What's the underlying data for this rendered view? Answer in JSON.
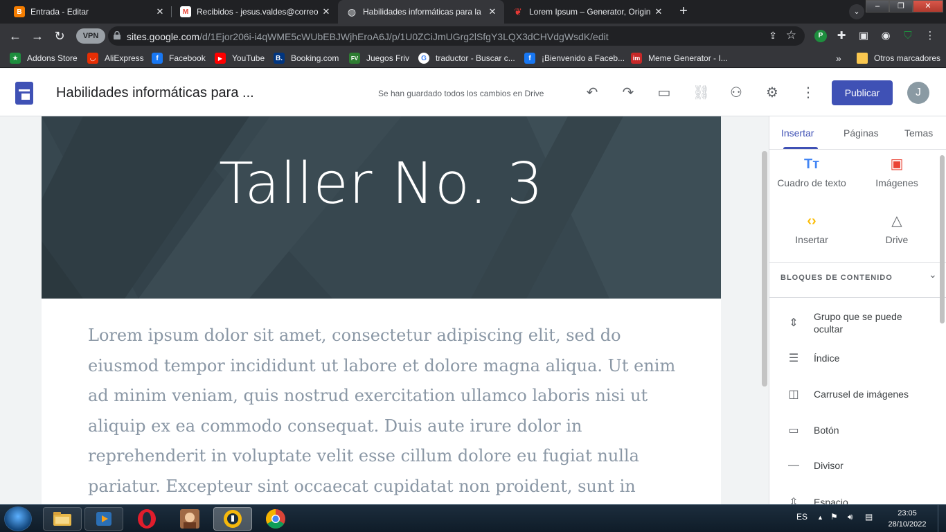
{
  "browser": {
    "tabs": [
      {
        "title": "Entrada - Editar",
        "icon": "blogger-icon",
        "color": "#f57d00"
      },
      {
        "title": "Recibidos - jesus.valdes@correo",
        "icon": "gmail-icon",
        "color": "#ea4335"
      },
      {
        "title": "Habilidades informáticas para la",
        "icon": "globe-icon",
        "color": "#e8eaed"
      },
      {
        "title": "Lorem Ipsum – Generator, Origin",
        "icon": "lorem-ipsum-icon",
        "color": "#e53935"
      }
    ],
    "vpn_label": "VPN",
    "url_host": "sites.google.com",
    "url_path": "/d/1Ejor206i-i4qWME5cWUbEBJWjhEroA6J/p/1U0ZCiJmUGrg2lSfgY3LQX3dCHVdgWsdK/edit",
    "bookmarks": [
      {
        "label": "Addons Store",
        "icon": "addons-store-icon",
        "color": "#1e8e3e"
      },
      {
        "label": "AliExpress",
        "icon": "aliexpress-icon",
        "color": "#e62e04"
      },
      {
        "label": "Facebook",
        "icon": "facebook-icon",
        "color": "#1877f2"
      },
      {
        "label": "YouTube",
        "icon": "youtube-icon",
        "color": "#ff0000"
      },
      {
        "label": "Booking.com",
        "icon": "booking-icon",
        "color": "#003580"
      },
      {
        "label": "Juegos Friv",
        "icon": "friv-icon",
        "color": "#2e7d32"
      },
      {
        "label": "traductor - Buscar c...",
        "icon": "google-icon",
        "color": "#ffffff"
      },
      {
        "label": "¡Bienvenido a Faceb...",
        "icon": "facebook-icon",
        "color": "#1877f2"
      },
      {
        "label": "Meme Generator - I...",
        "icon": "imgflip-icon",
        "color": "#c62828"
      }
    ],
    "bookmarks_more": "»",
    "other_bookmarks": "Otros marcadores"
  },
  "sites": {
    "doc_title": "Habilidades informáticas para ...",
    "saved_status": "Se han guardado todos los cambios en Drive",
    "publish_label": "Publicar",
    "avatar_letter": "J",
    "accent_color": "#3f51b5"
  },
  "page": {
    "hero_title": "Taller No. 3",
    "body_text": "Lorem ipsum dolor sit amet, consectetur adipiscing elit, sed do eiusmod tempor incididunt ut labore et dolore magna aliqua. Ut enim ad minim veniam, quis nostrud exercitation ullamco laboris nisi ut aliquip ex ea commodo consequat. Duis aute irure dolor in reprehenderit in voluptate velit esse cillum dolore eu fugiat nulla pariatur. Excepteur sint occaecat cupidatat non proident, sunt in culpa qui officia deserunt mollit anim id"
  },
  "panel": {
    "tabs": [
      "Insertar",
      "Páginas",
      "Temas"
    ],
    "insert_items": [
      {
        "label": "Cuadro de texto",
        "icon": "text-box-icon"
      },
      {
        "label": "Imágenes",
        "icon": "image-icon"
      },
      {
        "label": "Insertar",
        "icon": "embed-code-icon"
      },
      {
        "label": "Drive",
        "icon": "drive-icon"
      }
    ],
    "blocks_heading": "BLOQUES DE CONTENIDO",
    "blocks": [
      {
        "label": "Grupo que se puede ocultar",
        "icon": "collapsible-group-icon"
      },
      {
        "label": "Índice",
        "icon": "table-of-contents-icon"
      },
      {
        "label": "Carrusel de imágenes",
        "icon": "carousel-icon"
      },
      {
        "label": "Botón",
        "icon": "button-icon"
      },
      {
        "label": "Divisor",
        "icon": "divider-icon"
      },
      {
        "label": "Espacio",
        "icon": "spacer-icon"
      }
    ]
  },
  "taskbar": {
    "language": "ES",
    "time": "23:05",
    "date": "28/10/2022"
  }
}
